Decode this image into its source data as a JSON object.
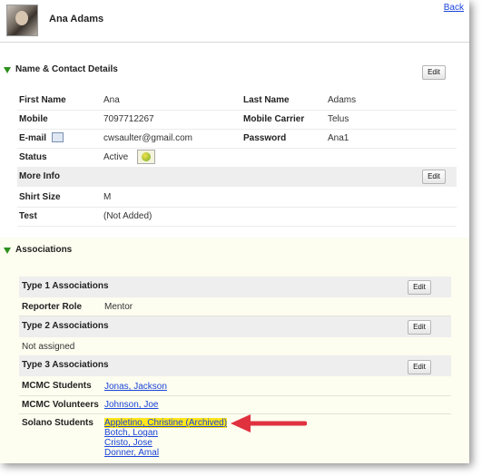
{
  "header": {
    "name": "Ana Adams",
    "back_label": "Back"
  },
  "contact": {
    "title": "Name & Contact Details",
    "edit_label": "Edit",
    "first_name_label": "First Name",
    "first_name": "Ana",
    "last_name_label": "Last Name",
    "last_name": "Adams",
    "mobile_label": "Mobile",
    "mobile": "7097712267",
    "carrier_label": "Mobile Carrier",
    "carrier": "Telus",
    "email_label": "E-mail",
    "email": "cwsaulter@gmail.com",
    "password_label": "Password",
    "password": "Ana1",
    "status_label": "Status",
    "status": "Active"
  },
  "more_info": {
    "title": "More Info",
    "edit_label": "Edit",
    "shirt_label": "Shirt Size",
    "shirt": "M",
    "test_label": "Test",
    "test": "(Not Added)"
  },
  "associations": {
    "title": "Associations",
    "type1": {
      "title": "Type 1 Associations",
      "edit_label": "Edit",
      "role_label": "Reporter Role",
      "role": "Mentor"
    },
    "type2": {
      "title": "Type 2 Associations",
      "edit_label": "Edit",
      "empty": "Not assigned"
    },
    "type3": {
      "title": "Type 3 Associations",
      "edit_label": "Edit",
      "mcmc_students_label": "MCMC Students",
      "mcmc_students": [
        "Jonas, Jackson"
      ],
      "mcmc_volunteers_label": "MCMC Volunteers",
      "mcmc_volunteers": [
        "Johnson, Joe"
      ],
      "solano_label": "Solano Students",
      "solano": [
        "Appletino, Christine (Archived)",
        "Botch, Logan",
        "Cristo, Jose",
        "Donner, Amal"
      ]
    }
  },
  "colors": {
    "link": "#1a44d8",
    "highlight": "#ffe61a",
    "arrow": "#e0313f",
    "triangle": "#2e8f1e"
  }
}
